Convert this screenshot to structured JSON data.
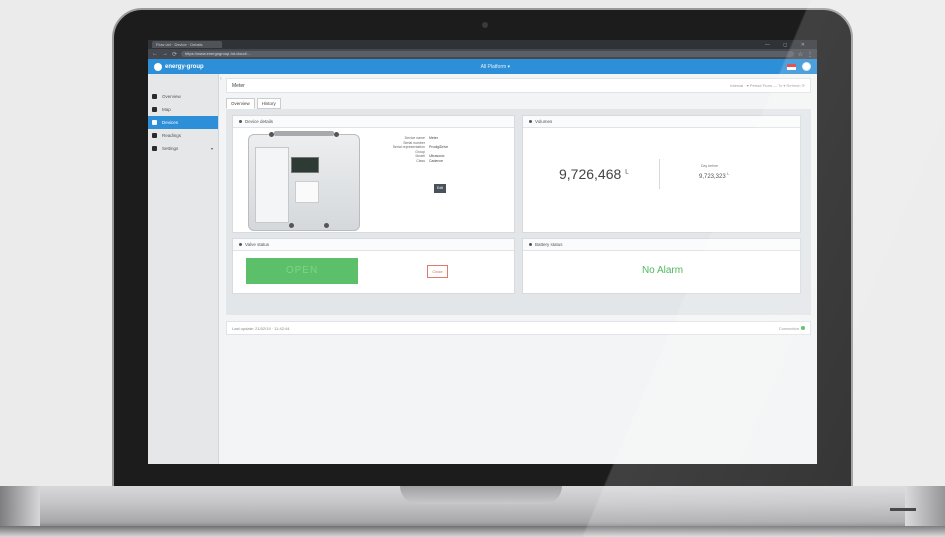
{
  "browser": {
    "tab_title": "Flow ctrl · Device · Details",
    "url": "https://www.energogroup-hd.cloud/...",
    "window_controls": "— ◻ ✕"
  },
  "app": {
    "name": "energy-group",
    "center_menu": "All Platform ▾",
    "accent_color": "#2d8fd7"
  },
  "sidebar": {
    "items": [
      {
        "label": "Overview",
        "icon": "dashboard-icon"
      },
      {
        "label": "Map",
        "icon": "map-icon"
      },
      {
        "label": "Devices",
        "icon": "device-icon"
      },
      {
        "label": "Readings",
        "icon": "readings-icon"
      },
      {
        "label": "Settings",
        "icon": "settings-icon"
      }
    ]
  },
  "page": {
    "title": "Meter",
    "tools": "Interval · ▾  Period  From — To ▾   Refresh ⟳",
    "tabs": [
      "Overview",
      "History"
    ]
  },
  "device_card": {
    "title": "Device details",
    "rows": [
      {
        "k": "Device name",
        "v": "Meter"
      },
      {
        "k": "Serial number",
        "v": ""
      },
      {
        "k": "Serial representation",
        "v": "ProdigiDrive"
      },
      {
        "k": "Group",
        "v": ""
      },
      {
        "k": "Model",
        "v": "Ultrasonic"
      },
      {
        "k": "Class",
        "v": "Cadence"
      }
    ],
    "edit_label": "Edit"
  },
  "volumes_card": {
    "title": "Volumes",
    "main_value": "9,726,468",
    "main_unit": "L",
    "sub_label": "Day before",
    "sub_value": "9,723,323",
    "sub_unit": "L"
  },
  "valve_card": {
    "title": "Valve status",
    "open_label": "OPEN",
    "close_label": "Close"
  },
  "battery_card": {
    "title": "Battery status",
    "status": "No Alarm"
  },
  "footer": {
    "last_update": "Last update: 21/02/19 · 11:42:44",
    "connection": "Connection"
  }
}
